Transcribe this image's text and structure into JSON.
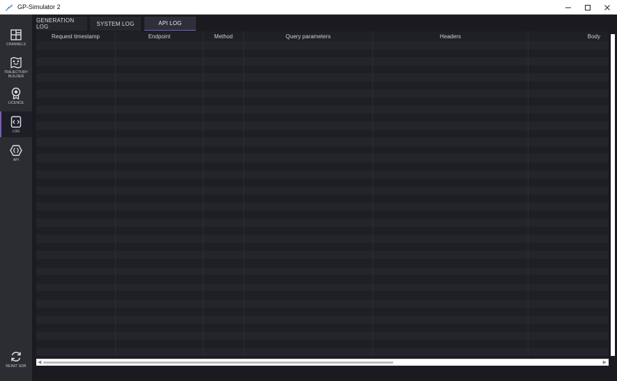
{
  "window": {
    "title": "GP-Simulator 2",
    "icons": {
      "app": "feather-icon",
      "minimize": "minimize-icon",
      "maximize": "maximize-icon",
      "close": "close-icon"
    }
  },
  "sidebar": {
    "items": [
      {
        "label": "CHANNELS",
        "icon": "grid-layout-icon"
      },
      {
        "label": "TRAJECTORY BUILDER",
        "icon": "route-map-icon"
      },
      {
        "label": "LICENCE",
        "icon": "award-badge-icon"
      },
      {
        "label": "LOG",
        "icon": "code-file-icon"
      },
      {
        "label": "API",
        "icon": "hexagon-code-icon"
      }
    ],
    "active_item": "LOG",
    "bottom": {
      "label": "REINIT SDR",
      "icon": "refresh-icon"
    }
  },
  "tabs": [
    {
      "label": "GENERATION LOG"
    },
    {
      "label": "SYSTEM LOG"
    },
    {
      "label": "API LOG"
    }
  ],
  "active_tab": "API LOG",
  "table": {
    "columns": [
      "Request timestamp",
      "Endpoint",
      "Method",
      "Query parameters",
      "Headers",
      "Body"
    ],
    "rows": []
  },
  "colors": {
    "accent": "#7a5cc0",
    "sidebar_bg": "#2c2c33",
    "content_bg": "#1a1a20"
  }
}
